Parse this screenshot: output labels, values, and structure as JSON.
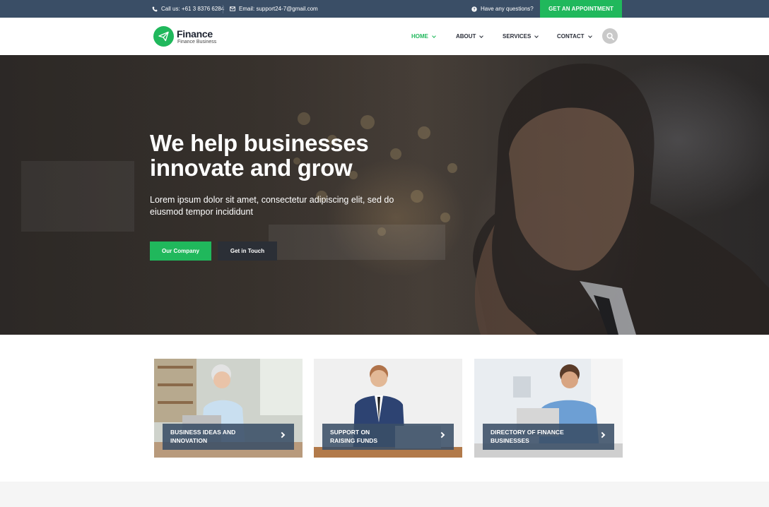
{
  "topbar": {
    "phone_text": "Call us: +61 3 8376 6284",
    "email_text": "Email: support24-7@gmail.com",
    "questions_text": "Have any questions?",
    "appointment_label": "GET AN APPOINTMENT"
  },
  "header": {
    "logo_title": "Finance",
    "logo_subtitle": "Finance Business",
    "nav": [
      {
        "label": "HOME",
        "active": true
      },
      {
        "label": "ABOUT"
      },
      {
        "label": "SERVICES"
      },
      {
        "label": "CONTACT"
      }
    ],
    "search_icon": "search-icon"
  },
  "hero": {
    "title_line1": "We help businesses",
    "title_line2": "innovate and grow",
    "text_line1": "Lorem ipsum dolor sit amet, consectetur adipiscing elit, sed do",
    "text_line2": "eiusmod tempor incididunt",
    "primary_button": "Our Company",
    "secondary_button": "Get in Touch"
  },
  "cards": [
    {
      "line1": "BUSINESS IDEAS AND",
      "line2": "INNOVATION"
    },
    {
      "line1": "SUPPORT ON",
      "line2": "RAISING FUNDS"
    },
    {
      "line1": "DIRECTORY OF FINANCE",
      "line2": "BUSINESSES"
    }
  ],
  "colors": {
    "topbar": "#3a4e66",
    "accent": "#20b85c",
    "dark_button": "#2b2f36",
    "caption_overlay": "#3a4e66"
  }
}
